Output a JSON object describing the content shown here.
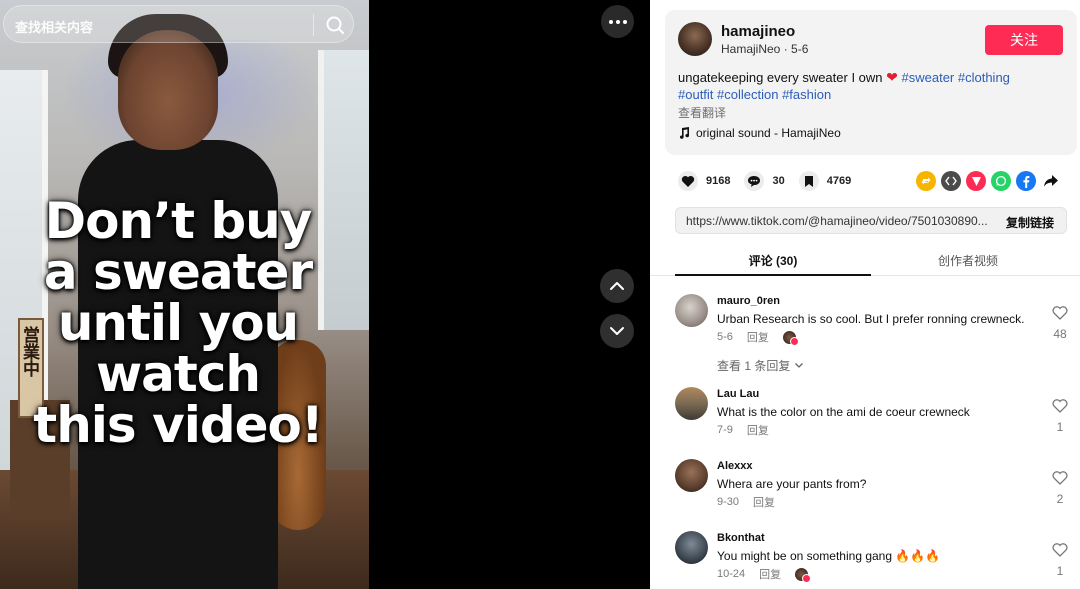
{
  "search": {
    "placeholder": "查找相关内容"
  },
  "video": {
    "overlay_lines": [
      "Don’t buy",
      "a sweater",
      "until you",
      "watch",
      "this video!"
    ],
    "sign_text": "営業中"
  },
  "post": {
    "username": "hamajineo",
    "display_name": "HamajiNeo",
    "date": "5-6",
    "follow_label": "关注",
    "description": "ungatekeeping every sweater I own",
    "hashtags_line1": "#sweater #clothing",
    "hashtags_line2": "#outfit #collection #fashion",
    "translate_label": "查看翻译",
    "sound": "original sound - HamajiNeo"
  },
  "stats": {
    "likes": "9168",
    "comments": "30",
    "saves": "4769"
  },
  "share": {
    "icons": [
      "repost-icon",
      "embed-icon",
      "send-icon",
      "whatsapp-icon",
      "facebook-icon",
      "share-arrow-icon"
    ]
  },
  "link": {
    "url": "https://www.tiktok.com/@hamajineo/video/7501030890...",
    "copy_label": "复制链接"
  },
  "tabs": {
    "comments": "评论 (30)",
    "creator_videos": "创作者视频"
  },
  "comments": [
    {
      "name": "mauro_0ren",
      "text": "Urban Research is so cool. But I prefer ronning crewneck.",
      "date": "5-6",
      "reply": "回复",
      "likes": "48",
      "view_replies": "查看 1 条回复"
    },
    {
      "name": "Lau Lau",
      "text": "What is the color on the ami de coeur crewneck",
      "date": "7-9",
      "reply": "回复",
      "likes": "1"
    },
    {
      "name": "Alexxx",
      "text": "Whera are your pants from?",
      "date": "9-30",
      "reply": "回复",
      "likes": "2"
    },
    {
      "name": "Bkonthat",
      "text": "You might be on something gang 🔥🔥🔥",
      "date": "10-24",
      "reply": "回复",
      "likes": "1"
    }
  ],
  "colors": {
    "accent": "#fe2c55",
    "hashtag": "#2b5db9"
  }
}
